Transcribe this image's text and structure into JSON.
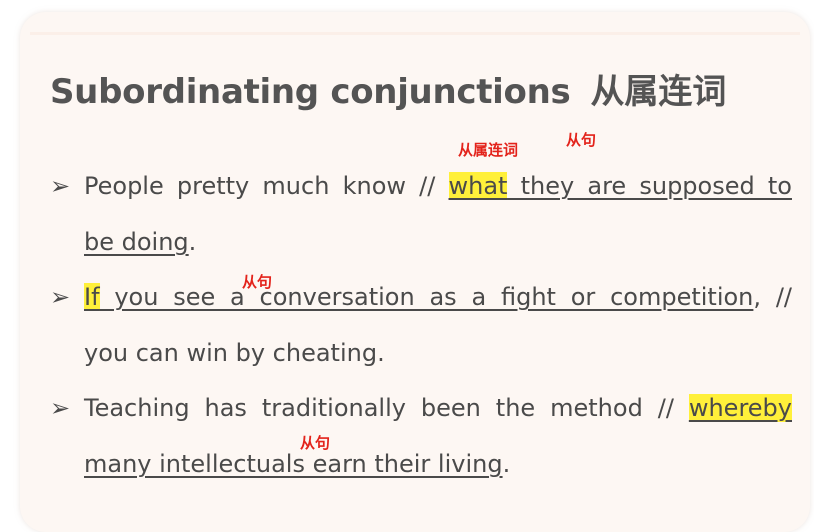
{
  "title": {
    "en": "Subordinating conjunctions",
    "cn": "从属连词"
  },
  "bullet_marker": "➢",
  "annotations": {
    "conjunction_label": "从属连词",
    "clause_label": "从句"
  },
  "bullets": [
    {
      "line1": {
        "before": "People pretty much know // ",
        "conjunction": "what",
        "clause": " they are supposed to"
      },
      "line2": {
        "clause": "be doing",
        "after": "."
      }
    },
    {
      "line1": {
        "conjunction": "If",
        "clause": " you see a conversation as a fight or competition",
        "after": ", //"
      },
      "line2": {
        "text": "you can win by cheating."
      }
    },
    {
      "line1": {
        "before": "Teaching has traditionally been the method // ",
        "conjunction": "whereby"
      },
      "line2": {
        "clause": "many intellectuals earn their living",
        "after": "."
      }
    }
  ],
  "colors": {
    "highlight": "#fff03a",
    "annotation": "#e3231b",
    "text": "#4a4a4a",
    "title": "#545454"
  }
}
